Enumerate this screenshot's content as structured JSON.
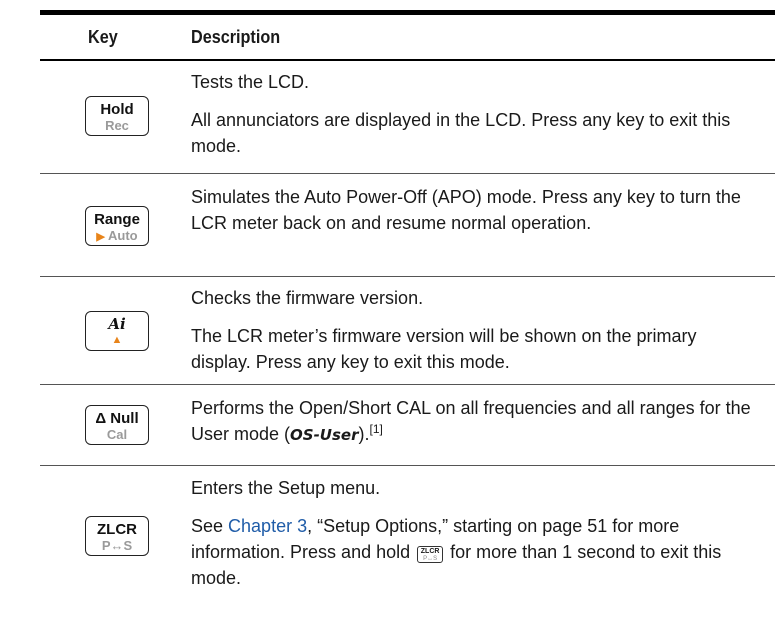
{
  "header": {
    "key_label": "Key",
    "description_label": "Description"
  },
  "rows": [
    {
      "key": {
        "top": "Hold",
        "bottom": "Rec"
      },
      "lines": [
        "Tests the LCD.",
        "All annunciators are displayed in the LCD. Press any key to exit this mode."
      ]
    },
    {
      "key": {
        "top": "Range",
        "bottom": "Auto",
        "arrow": "▶"
      },
      "lines": [
        "Simulates the Auto Power-Off (APO) mode. Press any key to turn the LCR meter back on and resume normal operation."
      ]
    },
    {
      "key": {
        "top": "Ai",
        "arrow": "▲"
      },
      "lines": [
        "Checks the firmware version.",
        "The LCR meter’s firmware version will be shown on the primary display. Press any key to exit this mode."
      ]
    },
    {
      "key": {
        "top": "Δ Null",
        "bottom": "Cal"
      },
      "text_a": "Performs the Open/Short CAL on all frequencies and all ranges for the User mode (",
      "code": "OS-User",
      "text_b": ").",
      "footnote": "[1]"
    },
    {
      "key": {
        "top": "ZLCR",
        "bottom": "P↔S"
      },
      "line1": "Enters the Setup menu.",
      "see": "See ",
      "chapter_link": "Chapter 3",
      "after_link": ", “Setup Options,” starting on page 51 for more information. Press and hold ",
      "after_key": " for more than 1 second to exit this mode.",
      "inline_key": {
        "top": "ZLCR",
        "bottom": "P↔S"
      }
    }
  ],
  "colors": {
    "link": "#1f5ca8",
    "arrow_accent": "#e8841a",
    "key_secondary": "#9a9a9a"
  }
}
